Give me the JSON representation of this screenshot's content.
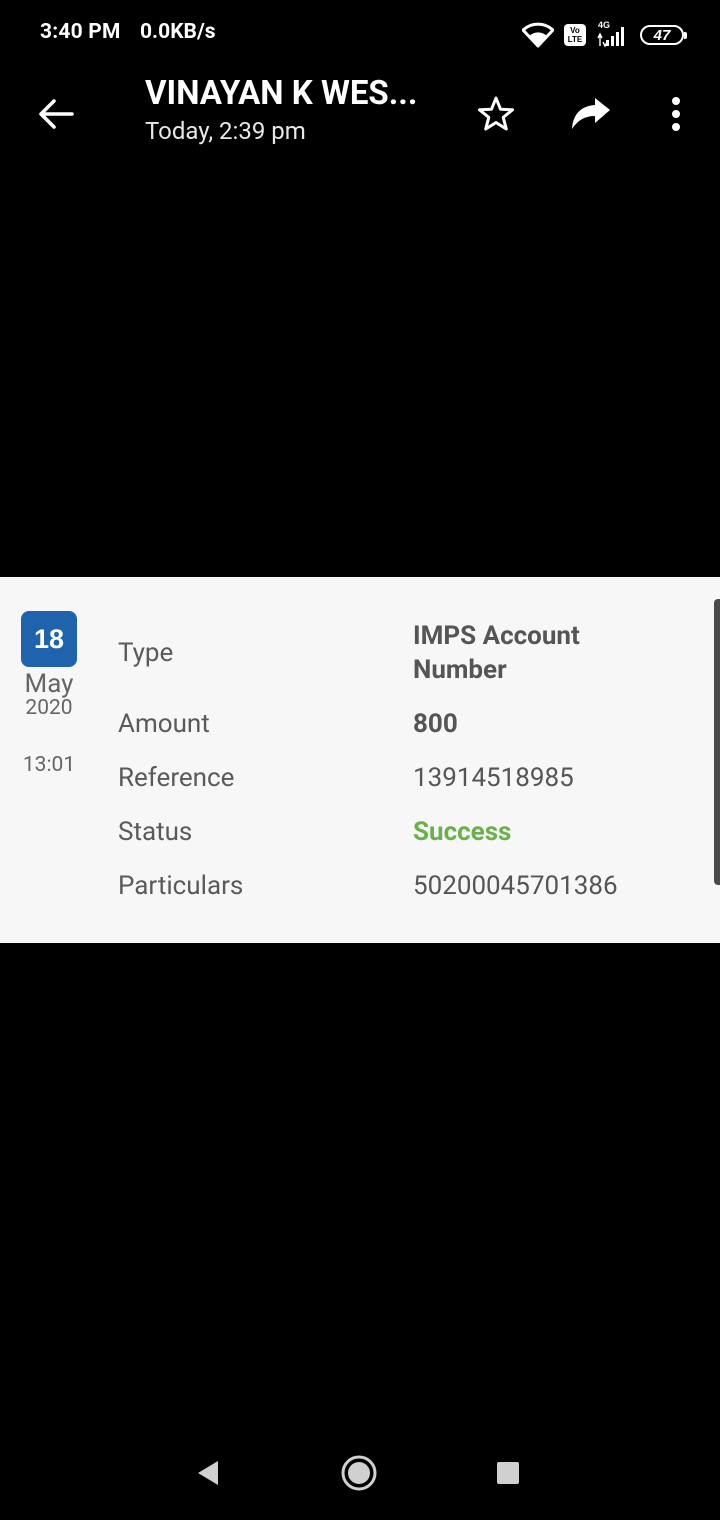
{
  "status_bar": {
    "time": "3:40 PM",
    "network_speed": "0.0KB/s",
    "volte_top": "Vo",
    "volte_bottom": "LTE",
    "network_type": "4G",
    "battery": "47"
  },
  "app_bar": {
    "title": "VINAYAN K WES...",
    "subtitle": "Today, 2:39 pm"
  },
  "transaction": {
    "day": "18",
    "month": "May",
    "year": "2020",
    "time": "13:01",
    "fields": [
      {
        "label": "Type",
        "value": "IMPS Account Number"
      },
      {
        "label": "Amount",
        "value": "800"
      },
      {
        "label": "Reference",
        "value": "13914518985"
      },
      {
        "label": "Status",
        "value": "Success"
      },
      {
        "label": "Particulars",
        "value": "50200045701386"
      }
    ]
  },
  "colors": {
    "badge": "#1f63ac",
    "success": "#6ab04c",
    "card_bg": "#f7f7f7"
  }
}
